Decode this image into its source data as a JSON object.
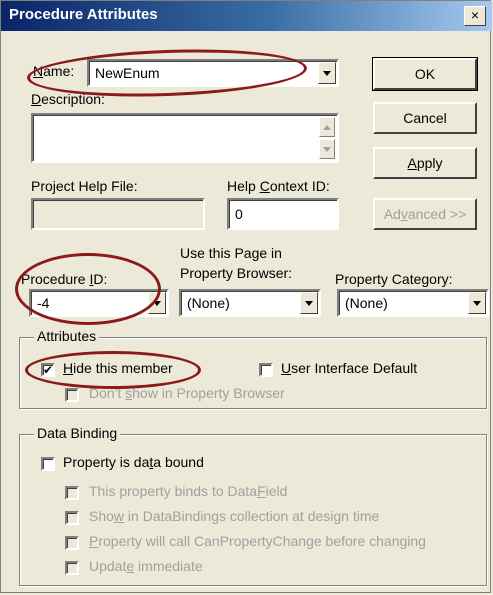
{
  "window": {
    "title": "Procedure Attributes",
    "close_glyph": "×"
  },
  "name": {
    "label": "Name:",
    "value": "NewEnum"
  },
  "description": {
    "label": "Description:",
    "value": ""
  },
  "project_help_file": {
    "label": "Project Help File:",
    "value": ""
  },
  "help_context_id": {
    "label": "Help Context ID:",
    "value": "0"
  },
  "buttons": {
    "ok": "OK",
    "cancel": "Cancel",
    "apply": "Apply",
    "advanced": "Advanced >>"
  },
  "procedure_id": {
    "label": "Procedure ID:",
    "value": "-4"
  },
  "use_page": {
    "label_line1": "Use this Page in",
    "label_line2": "Property Browser:",
    "value": "(None)"
  },
  "property_category": {
    "label": "Property Category:",
    "value": "(None)"
  },
  "attributes": {
    "title": "Attributes",
    "hide_member": {
      "label": "Hide this member",
      "checked": true,
      "check_glyph": "✔"
    },
    "ui_default": {
      "label": "User Interface Default",
      "checked": false
    },
    "dont_show": {
      "label": "Don't show in Property Browser",
      "checked": false
    }
  },
  "data_binding": {
    "title": "Data Binding",
    "is_bound": {
      "label": "Property is data bound",
      "checked": false
    },
    "options": [
      {
        "label": "This property binds to DataField"
      },
      {
        "label": "Show in DataBindings collection at design time"
      },
      {
        "label": "Property will call CanPropertyChange before changing"
      },
      {
        "label": "Update immediate"
      }
    ]
  },
  "colors": {
    "highlight_ellipse": "#8b1a1a",
    "titlebar": "#0a246a",
    "face": "#ece9d8"
  }
}
